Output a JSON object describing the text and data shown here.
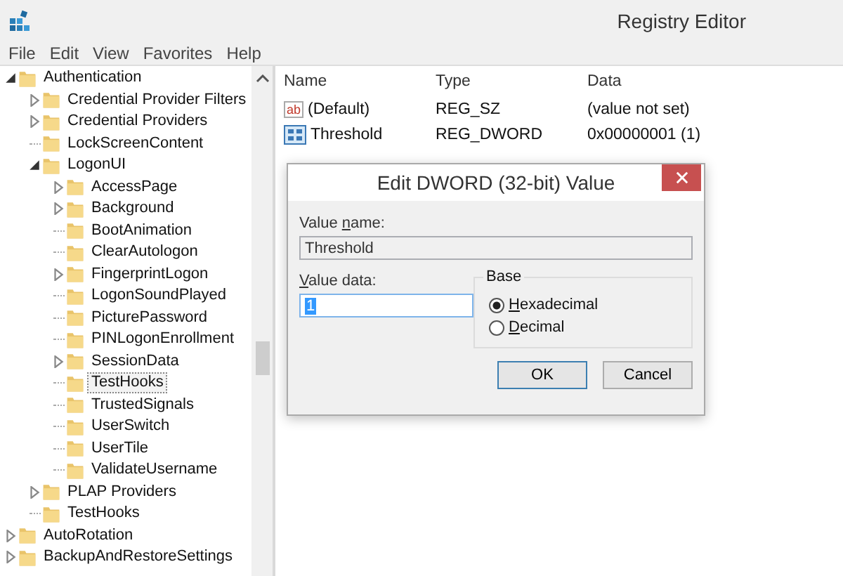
{
  "window": {
    "title": "Registry Editor"
  },
  "menu": [
    "File",
    "Edit",
    "View",
    "Favorites",
    "Help"
  ],
  "tree": [
    {
      "label": "Authentication",
      "expandable": true,
      "expanded": true,
      "selected": false,
      "children": [
        {
          "label": "Credential Provider Filters",
          "expandable": true,
          "expanded": false,
          "selected": false
        },
        {
          "label": "Credential Providers",
          "expandable": true,
          "expanded": false,
          "selected": false
        },
        {
          "label": "LockScreenContent",
          "expandable": false,
          "selected": false
        },
        {
          "label": "LogonUI",
          "expandable": true,
          "expanded": true,
          "selected": false,
          "children": [
            {
              "label": "AccessPage",
              "expandable": true,
              "expanded": false,
              "selected": false
            },
            {
              "label": "Background",
              "expandable": true,
              "expanded": false,
              "selected": false
            },
            {
              "label": "BootAnimation",
              "expandable": false,
              "selected": false
            },
            {
              "label": "ClearAutologon",
              "expandable": false,
              "selected": false
            },
            {
              "label": "FingerprintLogon",
              "expandable": true,
              "expanded": false,
              "selected": false
            },
            {
              "label": "LogonSoundPlayed",
              "expandable": false,
              "selected": false
            },
            {
              "label": "PicturePassword",
              "expandable": false,
              "selected": false
            },
            {
              "label": "PINLogonEnrollment",
              "expandable": false,
              "selected": false
            },
            {
              "label": "SessionData",
              "expandable": true,
              "expanded": false,
              "selected": false
            },
            {
              "label": "TestHooks",
              "expandable": false,
              "selected": true
            },
            {
              "label": "TrustedSignals",
              "expandable": false,
              "selected": false
            },
            {
              "label": "UserSwitch",
              "expandable": false,
              "selected": false
            },
            {
              "label": "UserTile",
              "expandable": false,
              "selected": false
            },
            {
              "label": "ValidateUsername",
              "expandable": false,
              "selected": false
            }
          ]
        },
        {
          "label": "PLAP Providers",
          "expandable": true,
          "expanded": false,
          "selected": false
        },
        {
          "label": "TestHooks",
          "expandable": false,
          "selected": false
        }
      ]
    },
    {
      "label": "AutoRotation",
      "expandable": true,
      "expanded": false,
      "selected": false
    },
    {
      "label": "BackupAndRestoreSettings",
      "expandable": true,
      "expanded": false,
      "selected": false
    }
  ],
  "values": {
    "columns": [
      "Name",
      "Type",
      "Data"
    ],
    "rows": [
      {
        "kind": "string",
        "icon_text": "ab",
        "name": "(Default)",
        "type": "REG_SZ",
        "data": "(value not set)"
      },
      {
        "kind": "binary",
        "name": "Threshold",
        "type": "REG_DWORD",
        "data": "0x00000001 (1)"
      }
    ]
  },
  "dialog": {
    "title": "Edit DWORD (32-bit) Value",
    "value_name_label": {
      "before": "Value ",
      "key": "n",
      "after": "ame:"
    },
    "value_name": "Threshold",
    "value_data_label": {
      "key": "V",
      "after": "alue data:"
    },
    "value_data": "1",
    "base": {
      "label": "Base",
      "options": [
        {
          "key": "H",
          "after": "exadecimal",
          "selected": true
        },
        {
          "key": "D",
          "after": "ecimal",
          "selected": false
        }
      ]
    },
    "buttons": [
      "OK",
      "Cancel"
    ]
  }
}
